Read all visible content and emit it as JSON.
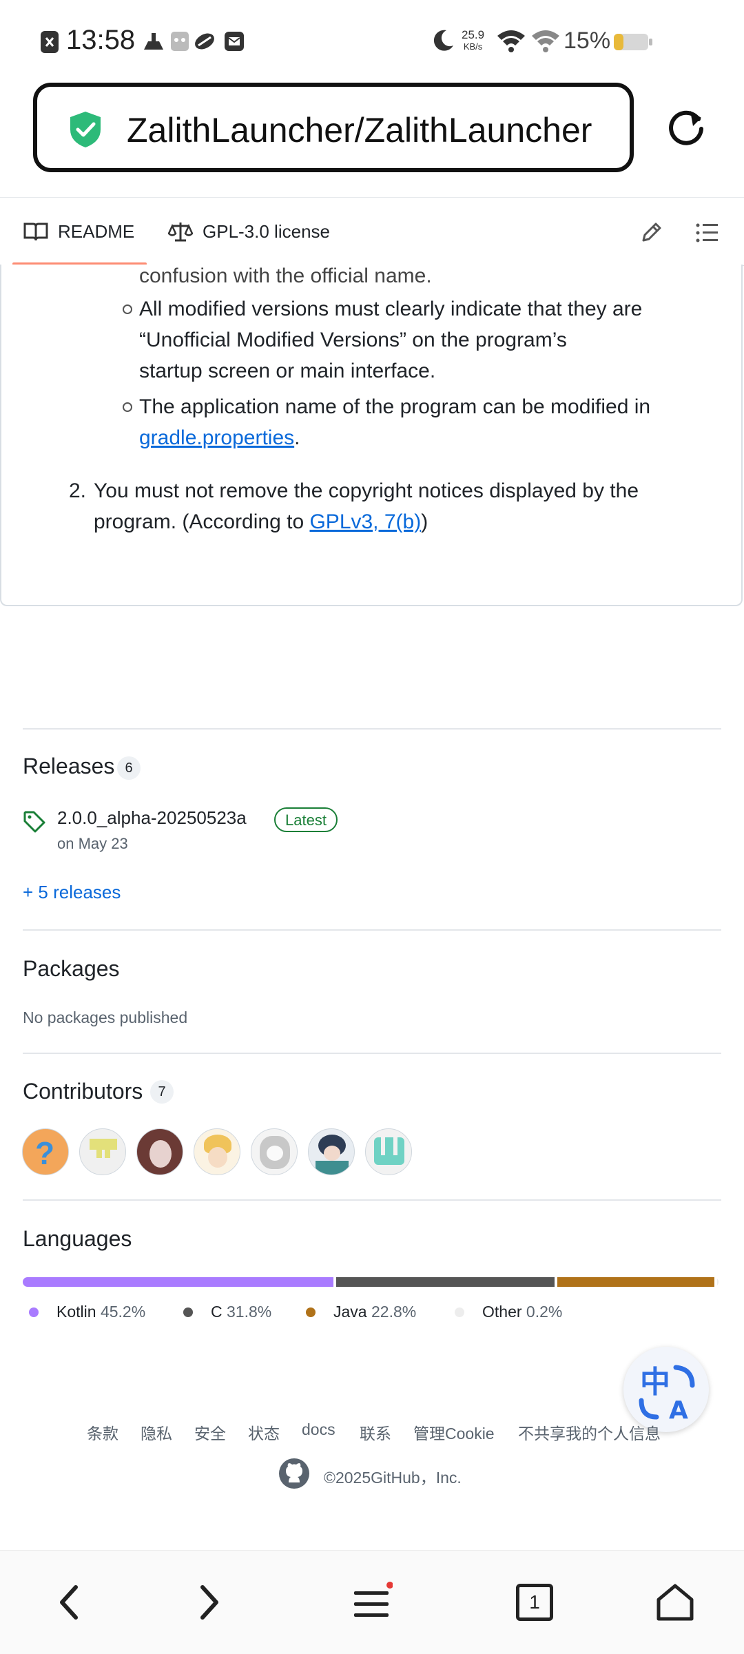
{
  "status_bar": {
    "time": "13:58",
    "net_speed_value": "25.9",
    "net_speed_unit": "KB/s",
    "battery_percent": "15%"
  },
  "browser": {
    "url_title": "ZalithLauncher/ZalithLauncher"
  },
  "readme_tabs": {
    "readme_label": "README",
    "license_label": "GPL-3.0 license"
  },
  "readme": {
    "line_cut": "confusion with the official name.",
    "bullet1": [
      "All modified versions must clearly indicate that they are",
      "“Unofficial Modified Versions” on the program’s",
      "startup screen or main interface."
    ],
    "bullet2_line1": "The application name of the program can be modified in",
    "bullet2_link": "gradle.properties",
    "bullet2_end": ".",
    "item2_number": "2.",
    "item2_line1": "You must not remove the copyright notices displayed by the",
    "item2_line2_pre": "program. (According to ",
    "item2_link": "GPLv3, 7(b)",
    "item2_line2_post": ")"
  },
  "releases": {
    "title": "Releases",
    "count": "6",
    "latest_name": "2.0.0_alpha-20250523a",
    "latest_badge": "Latest",
    "date": "on May 23",
    "more_link": "+ 5 releases"
  },
  "packages": {
    "title": "Packages",
    "empty_text": "No packages published"
  },
  "contributors": {
    "title": "Contributors",
    "count": "7"
  },
  "languages": {
    "title": "Languages",
    "items": [
      {
        "name": "Kotlin",
        "percent": "45.2%",
        "value": 45.2,
        "color": "#A97BFF"
      },
      {
        "name": "C",
        "percent": "31.8%",
        "value": 31.8,
        "color": "#555555"
      },
      {
        "name": "Java",
        "percent": "22.8%",
        "value": 22.8,
        "color": "#B07219"
      },
      {
        "name": "Other",
        "percent": "0.2%",
        "value": 0.2,
        "color": "#EDEDED"
      }
    ]
  },
  "footer": {
    "links": [
      "条款",
      "隐私",
      "安全",
      "状态",
      "docs",
      "联系",
      "管理Cookie",
      "不共享我的个人信息"
    ],
    "copyright": "©2025GitHub，Inc."
  },
  "bottom_nav": {
    "tab_count": "1"
  },
  "colors": {
    "accent_underline": "#fd8c73",
    "link": "#0969da",
    "latest_green": "#1a7f37",
    "shield_green": "#2dba79",
    "battery_yellow": "#e8b93a"
  }
}
